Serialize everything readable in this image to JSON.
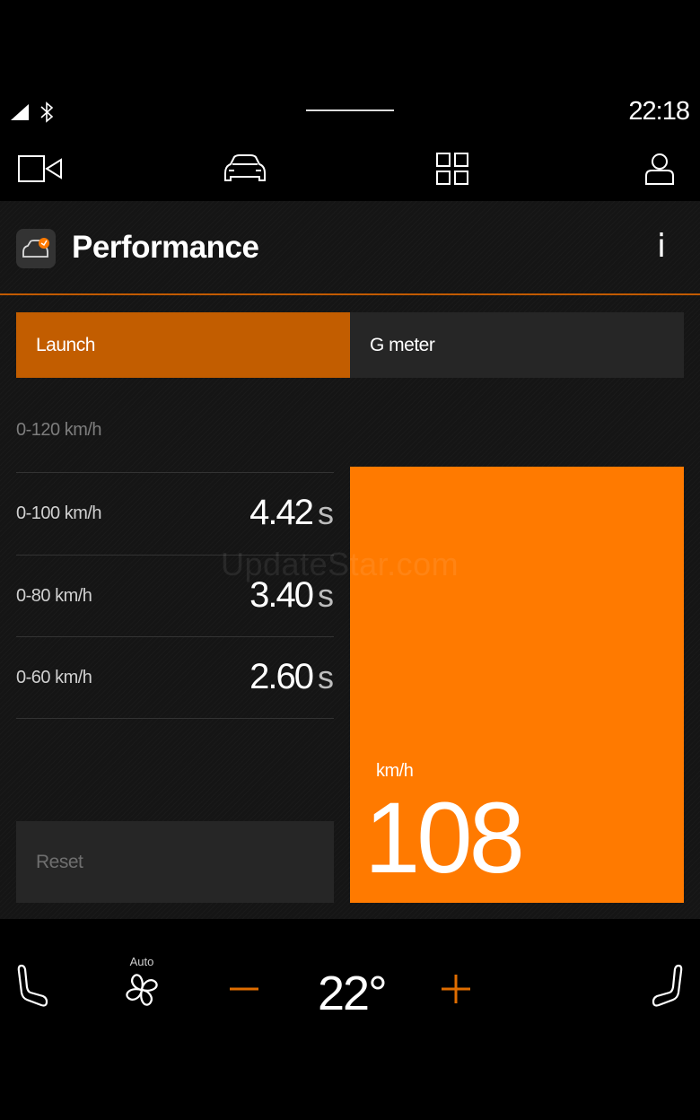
{
  "status_bar": {
    "time": "22:18",
    "icons": [
      "signal-icon",
      "bluetooth-icon"
    ]
  },
  "top_nav": {
    "items": [
      {
        "name": "camera",
        "icon": "camera-icon"
      },
      {
        "name": "car",
        "icon": "car-icon"
      },
      {
        "name": "apps",
        "icon": "apps-grid-icon"
      },
      {
        "name": "profile",
        "icon": "profile-icon"
      }
    ]
  },
  "app": {
    "title": "Performance",
    "info_label": "i",
    "icon": "performance-app-icon",
    "accent_color": "#ff7a00",
    "tab_active_color": "#c25d00"
  },
  "tabs": [
    {
      "label": "Launch",
      "active": true
    },
    {
      "label": "G meter",
      "active": false
    }
  ],
  "results": {
    "top_label": "0-120 km/h",
    "rows": [
      {
        "label": "0-100 km/h",
        "value": "4.42",
        "unit": "s"
      },
      {
        "label": "0-80 km/h",
        "value": "3.40",
        "unit": "s"
      },
      {
        "label": "0-60 km/h",
        "value": "2.60",
        "unit": "s"
      }
    ]
  },
  "reset_label": "Reset",
  "speed": {
    "unit": "km/h",
    "value": "108"
  },
  "watermark": "UpdateStar.com",
  "climate": {
    "fan_mode": "Auto",
    "temperature": "22°",
    "icons": [
      "seat-heat-left-icon",
      "fan-icon",
      "minus-icon",
      "plus-icon",
      "seat-heat-right-icon"
    ]
  }
}
